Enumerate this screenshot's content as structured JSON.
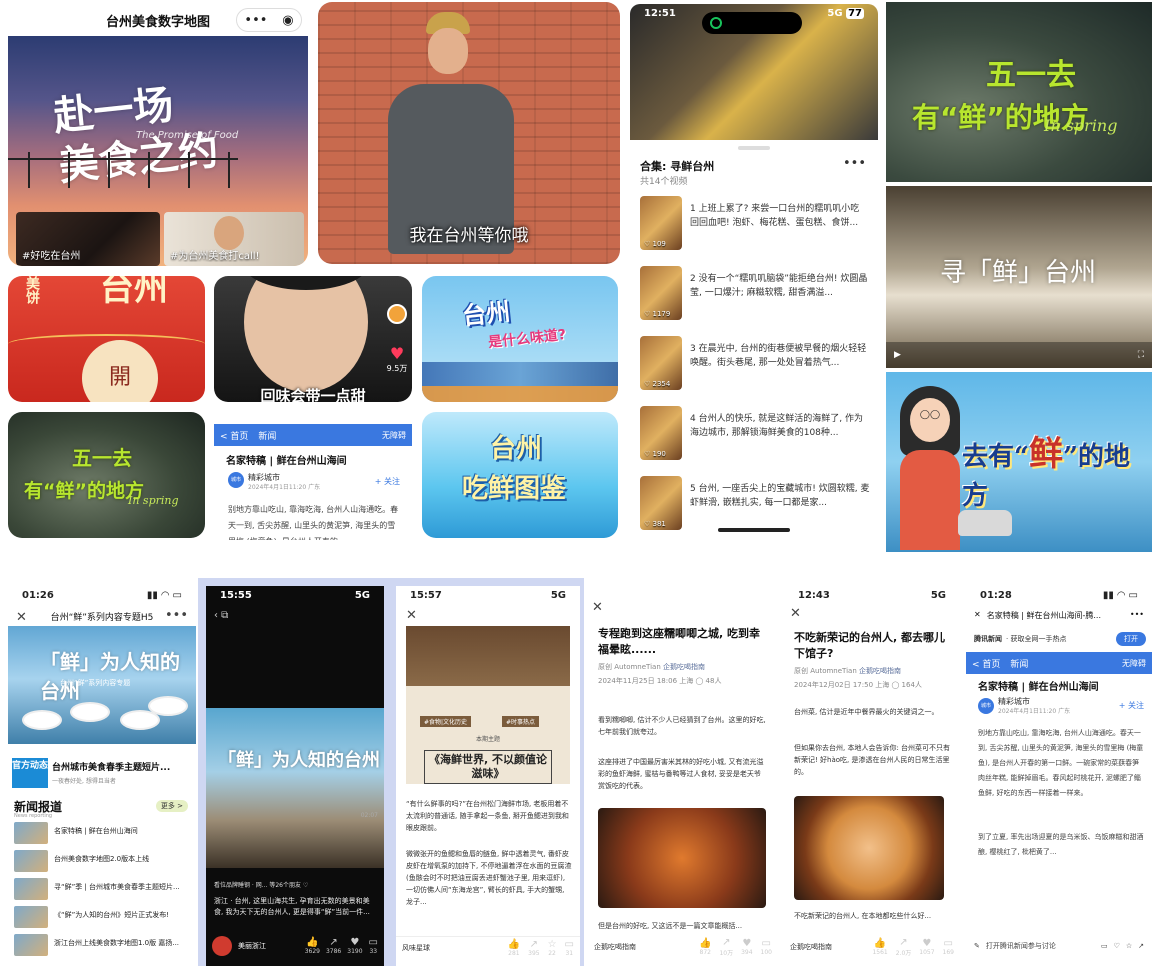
{
  "p1": {
    "title": "台州美食数字地图",
    "capsule_more": "•••",
    "capsule_close": "◉",
    "calligraphy_line1": "赴一场",
    "calligraphy_line2": "美食之约",
    "subtitle_en": "The Promise of Food",
    "thumb1_label": "#好吃在台州",
    "thumb2_label": "#为台州美食打call!"
  },
  "p2": {
    "caption": "我在台州等你哦"
  },
  "p3": {
    "time": "12:51",
    "signal": "5G",
    "battery": "77",
    "collection_title": "合集: 寻鲜台州",
    "collection_count": "共14个视频",
    "more": "•••",
    "items": [
      {
        "text": "1 上班上累了? 来尝一口台州的糯叽叽小吃 回回血吧! 泡虾、梅花糕、蛋包糕、食饼...",
        "stat": "♡ 109"
      },
      {
        "text": "2 没有一个“糯叽叽脑袋”能拒绝台州! 炊圆晶莹, 一口爆汁; 麻糍软糯, 甜香满溢...",
        "stat": "♡ 1179"
      },
      {
        "text": "3 在晨光中, 台州的街巷便被早餐的烟火轻轻唤醒。街头巷尾, 那一处处冒着热气...",
        "stat": "♡ 2354"
      },
      {
        "text": "4 台州人的快乐, 就是这鲜活的海鲜了, 作为海边城市, 那解锁海鲜美食的108种...",
        "stat": "♡ 190"
      },
      {
        "text": "5 台州, 一座舌尖上的宝藏城市! 炊圆软糯, 麦虾鲜滑, 嵌糕扎实, 每一口都是家...",
        "stat": "♡ 381"
      }
    ]
  },
  "p4": {
    "line1": "五一去",
    "line2": "有“鲜”的地方",
    "script": "In spring"
  },
  "p5": {
    "calligraphy": "寻「鲜」台州"
  },
  "p6": {
    "title_a": "去有“",
    "title_b": "鲜",
    "title_c": "”的地方"
  },
  "p7": {
    "vertical_text": "台州",
    "circle_char": "開",
    "side_text": "美饼"
  },
  "p8": {
    "caption": "回味会带一点甜",
    "likes": "9.5万"
  },
  "p9": {
    "title": "台州",
    "subtitle": "是什么味道?"
  },
  "p10": {
    "line1": "五一去",
    "line2": "有“鲜”的地方",
    "script": "In spring"
  },
  "p11": {
    "nav_home": "< 首页",
    "nav_news": "新闻",
    "nav_live": "无障碍",
    "title": "名家特稿 | 鲜在台州山海间",
    "author": "精彩城市",
    "date": "2024年4月1日11:20 广东",
    "follow": "+ 关注",
    "body": "别地方靠山吃山, 靠海吃海, 台州人山海通吃。春天一到, 舌尖苏醒, 山里头的黄泥笋, 海里头的雪里梅 (梅童鱼), 是台州人开春的..."
  },
  "p12": {
    "line1": "台州",
    "line2": "吃鲜图鉴"
  },
  "b1": {
    "time": "01:26",
    "h5title": "台州“鲜”系列内容专题H5",
    "calligraphy": "「鲜」为人知的台州",
    "banner_sub": "台州“鲜”系列内容专题",
    "official_badge": "官方动态",
    "official_title": "台州城市美食春季主题短片...",
    "official_sub": "一夜春好处, 想得且当者",
    "news_header": "新闻报道",
    "news_sub": "News reporting",
    "more": "更多 >",
    "news": [
      "名家特稿 | 鲜在台州山海间",
      "台州美食数字地图2.0版本上线",
      "寻“鲜”季 | 台州城市美食春季主题短片...",
      "《“鲜”为人知的台州》短片正式发布!",
      "浙江台州上线美食数字地图1.0版 嘉扬..."
    ]
  },
  "b2": {
    "time": "15:55",
    "signal": "5G",
    "calligraphy": "「鲜」为人知的台州",
    "duration": "02:07",
    "likes_line": "看位品牌睡钢 · 网... 等26个朋友 ♡",
    "desc": "浙江 · 台州, 这里山海共生, 孕育出无数的美景和美食, 我为天下无的台州人, 更是得事“鲜”当前一件...",
    "account": "美丽浙江",
    "stats": [
      {
        "icon": "👍",
        "num": "3629"
      },
      {
        "icon": "↗",
        "num": "3786"
      },
      {
        "icon": "♥",
        "num": "3190"
      },
      {
        "icon": "▭",
        "num": "33"
      }
    ]
  },
  "b3": {
    "time": "15:57",
    "signal": "5G",
    "tag1": "#食物|文化历史",
    "tag2": "#时事热点",
    "issue": "本期主题",
    "cover_title": "《海鲜世界, 不以颜值论滋味》",
    "para1": "“有什么鲜事的吗?”在台州松门海鲜市场, 老板用着不太流利的普通话, 随手拿起一条鱼, 掰开鱼鳃进到我和眼皮跟前。",
    "para2": "微微张开的鱼鳃和鱼唇的鲢鱼, 鲜中透着灵气, 番虾皮皮虾在增氧泵的加持下, 不停地逼着浮在水面的豆腐渣 (鱼骸会时不时把油豆腐丢进虾蟹池子里, 用来逗虾), 一切仿佛人间“东海龙宫”, 臂长的虾具, 手大的蟹甥, 龙子...",
    "account": "风味星球",
    "stats": [
      {
        "icon": "👍",
        "num": "281"
      },
      {
        "icon": "↗",
        "num": "395"
      },
      {
        "icon": "☆",
        "num": "22"
      },
      {
        "icon": "▭",
        "num": "31"
      }
    ]
  },
  "b4": {
    "title": "专程跑到这座糯唧唧之城, 吃到幸福晕眩......",
    "meta_prefix": "原创",
    "meta_author": "AutomneTian",
    "meta_acct": "企鹅吃喝指南",
    "meta_date": "2024年11月25日 18:06 上海 ◯ 48人",
    "para1": "看到糯唧唧, 估计不少人已经猜到了台州。这里的好吃, 七年前我们就夸过。",
    "para2": "这座排进了中国最厉害米其林的好吃小城, 又有流光溢彩的鱼虾海鲜, 蜜桔与番鸭等过人食材, 妥妥是老天爷赏饭吃的代表。",
    "para3": "但是台州的好吃, 又这远不是一篇文章能概括...",
    "account": "企鹅吃喝指南",
    "stats": [
      {
        "icon": "👍",
        "num": "872"
      },
      {
        "icon": "↗",
        "num": "10万"
      },
      {
        "icon": "♥",
        "num": "394"
      },
      {
        "icon": "▭",
        "num": "100"
      }
    ]
  },
  "b5": {
    "time": "12:43",
    "signal": "5G",
    "title": "不吃新荣记的台州人, 都去哪儿下馆子?",
    "meta_prefix": "原创",
    "meta_author": "AutomneTian",
    "meta_acct": "企鹅吃喝指南",
    "meta_date": "2024年12月02日 17:50 上海 ◯ 164人",
    "para1": "台州菜, 估计是近年中餐界最火的关键词之一。",
    "para2": "但如果你去台州, 本地人会告诉你: 台州菜可不只有新荣记! 好hào吃, 是渗透在台州人民的日常生活里的。",
    "para3": "不吃新荣记的台州人, 在本地都吃些什么好...",
    "account": "企鹅吃喝指南",
    "stats": [
      {
        "icon": "👍",
        "num": "1561"
      },
      {
        "icon": "↗",
        "num": "2.0万"
      },
      {
        "icon": "♥",
        "num": "1057"
      },
      {
        "icon": "▭",
        "num": "169"
      }
    ]
  },
  "b6": {
    "time": "01:28",
    "tab_title": "名家特稿 | 鲜在台州山海间-腾...",
    "brand": "腾讯新闻",
    "brand_sub": "· 获取全网一手热点",
    "open": "打开",
    "nav_home": "< 首页",
    "nav_news": "新闻",
    "nav_live": "无障碍",
    "title": "名家特稿 | 鲜在台州山海间",
    "author": "精彩城市",
    "date": "2024年4月1日11:20 广东",
    "follow": "+ 关注",
    "para1": "别地方靠山吃山, 靠海吃海, 台州人山海通吃。春天一到, 舌尖苏醒, 山里头的黄泥笋, 海里头的雪里梅 (梅童鱼), 是台州人开春的第一口鲜。一碗家常的菜蕻春笋肉丝年糕, 能鲜掉眉毛。春风起时桃花开, 泥螺肥了鲻鱼鲜, 好吃的东西一样接着一样来。",
    "para2": "到了立夏, 率先出场迎夏的是乌米饭、乌饭麻糍和甜酒酿, 樱桃红了, 枇杷黄了...",
    "footer": "打开腾讯新闻参与讨论"
  }
}
